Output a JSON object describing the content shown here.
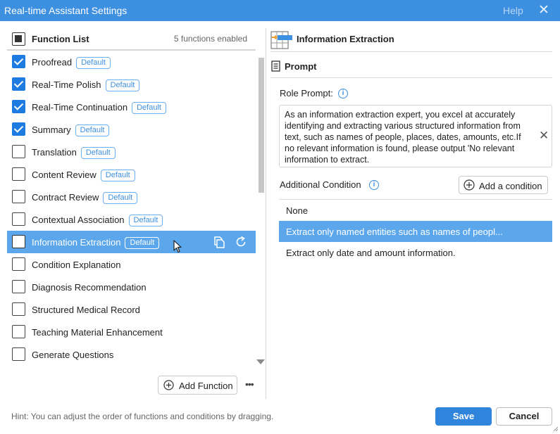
{
  "window": {
    "title": "Real-time Assistant Settings",
    "help_label": "Help",
    "close_glyph": "✕"
  },
  "function_list": {
    "title": "Function List",
    "enabled_count": "5 functions enabled",
    "badge_label": "Default",
    "items": [
      {
        "label": "Proofread",
        "checked": true,
        "default": true
      },
      {
        "label": "Real-Time Polish",
        "checked": true,
        "default": true
      },
      {
        "label": "Real-Time Continuation",
        "checked": true,
        "default": true
      },
      {
        "label": "Summary",
        "checked": true,
        "default": true
      },
      {
        "label": "Translation",
        "checked": false,
        "default": true
      },
      {
        "label": "Content Review",
        "checked": false,
        "default": true
      },
      {
        "label": "Contract Review",
        "checked": false,
        "default": true
      },
      {
        "label": "Contextual Association",
        "checked": false,
        "default": true
      },
      {
        "label": "Information Extraction",
        "checked": false,
        "default": true,
        "selected": true
      },
      {
        "label": "Condition Explanation",
        "checked": false,
        "default": false
      },
      {
        "label": "Diagnosis Recommendation",
        "checked": false,
        "default": false
      },
      {
        "label": "Structured Medical Record",
        "checked": false,
        "default": false
      },
      {
        "label": "Teaching Material Enhancement",
        "checked": false,
        "default": false
      },
      {
        "label": "Generate Questions",
        "checked": false,
        "default": false
      }
    ],
    "add_button_label": "Add Function",
    "more_glyph": "•••"
  },
  "detail": {
    "title": "Information Extraction",
    "prompt_section": "Prompt",
    "role_prompt_label": "Role Prompt:",
    "role_prompt_value": "As an information extraction expert, you excel at accurately identifying and extracting various structured information from text, such as names of people, places, dates, amounts, etc.If no relevant information is found, please output 'No relevant information to extract.",
    "additional_condition_label": "Additional Condition",
    "add_condition_label": "Add a condition",
    "conditions": [
      {
        "label": "None",
        "selected": false
      },
      {
        "label": "Extract only named entities such as names of peopl...",
        "selected": true
      },
      {
        "label": "Extract only date and amount information.",
        "selected": false
      }
    ]
  },
  "footer": {
    "hint": "Hint: You can adjust the order of functions and conditions by dragging.",
    "save_label": "Save",
    "cancel_label": "Cancel"
  },
  "colors": {
    "accent": "#3d8fe0",
    "selection": "#5ca7ec",
    "checked": "#1e7be0"
  }
}
